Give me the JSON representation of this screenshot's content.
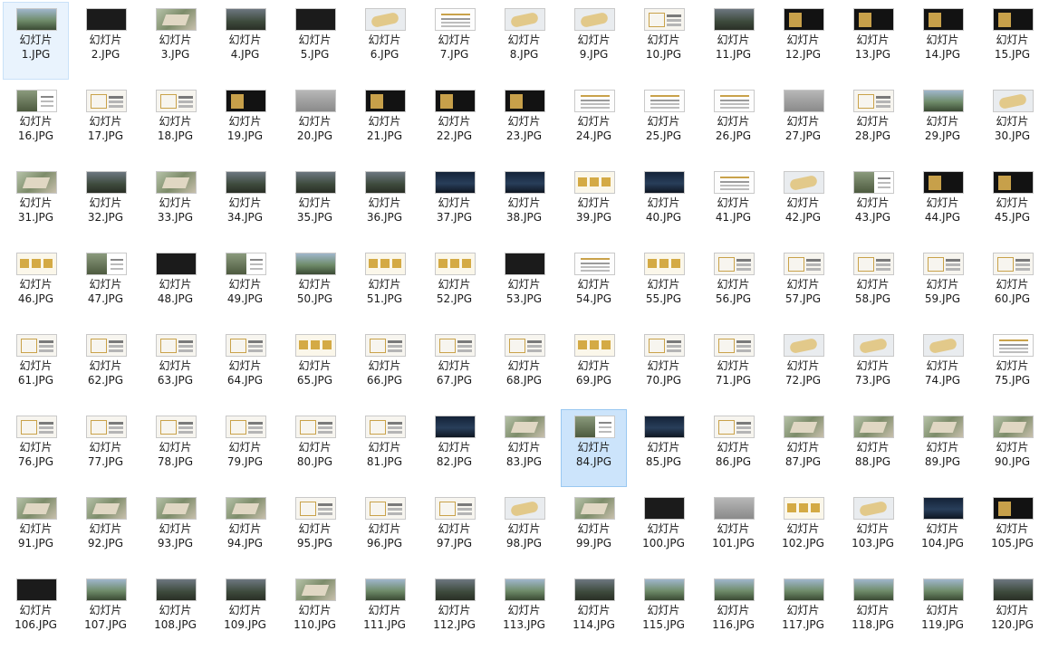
{
  "file_label_prefix": "幻灯片",
  "selected": [
    "84.JPG"
  ],
  "hovered": [
    "1.JPG"
  ],
  "files": [
    {
      "name": "1.JPG",
      "thumb": "t-sky"
    },
    {
      "name": "2.JPG",
      "thumb": "t-dark"
    },
    {
      "name": "3.JPG",
      "thumb": "t-aerial"
    },
    {
      "name": "4.JPG",
      "thumb": "t-photo"
    },
    {
      "name": "5.JPG",
      "thumb": "t-dark"
    },
    {
      "name": "6.JPG",
      "thumb": "t-map"
    },
    {
      "name": "7.JPG",
      "thumb": "t-doc"
    },
    {
      "name": "8.JPG",
      "thumb": "t-map"
    },
    {
      "name": "9.JPG",
      "thumb": "t-map"
    },
    {
      "name": "10.JPG",
      "thumb": "t-plan"
    },
    {
      "name": "11.JPG",
      "thumb": "t-photo"
    },
    {
      "name": "12.JPG",
      "thumb": "t-blackgold"
    },
    {
      "name": "13.JPG",
      "thumb": "t-blackgold"
    },
    {
      "name": "14.JPG",
      "thumb": "t-blackgold"
    },
    {
      "name": "15.JPG",
      "thumb": "t-blackgold"
    },
    {
      "name": "16.JPG",
      "thumb": "t-split"
    },
    {
      "name": "17.JPG",
      "thumb": "t-plan"
    },
    {
      "name": "18.JPG",
      "thumb": "t-plan"
    },
    {
      "name": "19.JPG",
      "thumb": "t-blackgold"
    },
    {
      "name": "20.JPG",
      "thumb": "t-gray"
    },
    {
      "name": "21.JPG",
      "thumb": "t-blackgold"
    },
    {
      "name": "22.JPG",
      "thumb": "t-blackgold"
    },
    {
      "name": "23.JPG",
      "thumb": "t-blackgold"
    },
    {
      "name": "24.JPG",
      "thumb": "t-doc"
    },
    {
      "name": "25.JPG",
      "thumb": "t-doc"
    },
    {
      "name": "26.JPG",
      "thumb": "t-doc"
    },
    {
      "name": "27.JPG",
      "thumb": "t-gray"
    },
    {
      "name": "28.JPG",
      "thumb": "t-plan"
    },
    {
      "name": "29.JPG",
      "thumb": "t-sky"
    },
    {
      "name": "30.JPG",
      "thumb": "t-map"
    },
    {
      "name": "31.JPG",
      "thumb": "t-aerial"
    },
    {
      "name": "32.JPG",
      "thumb": "t-photo"
    },
    {
      "name": "33.JPG",
      "thumb": "t-aerial"
    },
    {
      "name": "34.JPG",
      "thumb": "t-photo"
    },
    {
      "name": "35.JPG",
      "thumb": "t-photo"
    },
    {
      "name": "36.JPG",
      "thumb": "t-photo"
    },
    {
      "name": "37.JPG",
      "thumb": "t-night"
    },
    {
      "name": "38.JPG",
      "thumb": "t-night"
    },
    {
      "name": "39.JPG",
      "thumb": "t-gold"
    },
    {
      "name": "40.JPG",
      "thumb": "t-night"
    },
    {
      "name": "41.JPG",
      "thumb": "t-doc"
    },
    {
      "name": "42.JPG",
      "thumb": "t-map"
    },
    {
      "name": "43.JPG",
      "thumb": "t-split"
    },
    {
      "name": "44.JPG",
      "thumb": "t-blackgold"
    },
    {
      "name": "45.JPG",
      "thumb": "t-blackgold"
    },
    {
      "name": "46.JPG",
      "thumb": "t-gold"
    },
    {
      "name": "47.JPG",
      "thumb": "t-split"
    },
    {
      "name": "48.JPG",
      "thumb": "t-dark"
    },
    {
      "name": "49.JPG",
      "thumb": "t-split"
    },
    {
      "name": "50.JPG",
      "thumb": "t-sky"
    },
    {
      "name": "51.JPG",
      "thumb": "t-gold"
    },
    {
      "name": "52.JPG",
      "thumb": "t-gold"
    },
    {
      "name": "53.JPG",
      "thumb": "t-dark"
    },
    {
      "name": "54.JPG",
      "thumb": "t-doc"
    },
    {
      "name": "55.JPG",
      "thumb": "t-gold"
    },
    {
      "name": "56.JPG",
      "thumb": "t-plan"
    },
    {
      "name": "57.JPG",
      "thumb": "t-plan"
    },
    {
      "name": "58.JPG",
      "thumb": "t-plan"
    },
    {
      "name": "59.JPG",
      "thumb": "t-plan"
    },
    {
      "name": "60.JPG",
      "thumb": "t-plan"
    },
    {
      "name": "61.JPG",
      "thumb": "t-plan"
    },
    {
      "name": "62.JPG",
      "thumb": "t-plan"
    },
    {
      "name": "63.JPG",
      "thumb": "t-plan"
    },
    {
      "name": "64.JPG",
      "thumb": "t-plan"
    },
    {
      "name": "65.JPG",
      "thumb": "t-gold"
    },
    {
      "name": "66.JPG",
      "thumb": "t-plan"
    },
    {
      "name": "67.JPG",
      "thumb": "t-plan"
    },
    {
      "name": "68.JPG",
      "thumb": "t-plan"
    },
    {
      "name": "69.JPG",
      "thumb": "t-gold"
    },
    {
      "name": "70.JPG",
      "thumb": "t-plan"
    },
    {
      "name": "71.JPG",
      "thumb": "t-plan"
    },
    {
      "name": "72.JPG",
      "thumb": "t-map"
    },
    {
      "name": "73.JPG",
      "thumb": "t-map"
    },
    {
      "name": "74.JPG",
      "thumb": "t-map"
    },
    {
      "name": "75.JPG",
      "thumb": "t-doc"
    },
    {
      "name": "76.JPG",
      "thumb": "t-plan"
    },
    {
      "name": "77.JPG",
      "thumb": "t-plan"
    },
    {
      "name": "78.JPG",
      "thumb": "t-plan"
    },
    {
      "name": "79.JPG",
      "thumb": "t-plan"
    },
    {
      "name": "80.JPG",
      "thumb": "t-plan"
    },
    {
      "name": "81.JPG",
      "thumb": "t-plan"
    },
    {
      "name": "82.JPG",
      "thumb": "t-night"
    },
    {
      "name": "83.JPG",
      "thumb": "t-aerial"
    },
    {
      "name": "84.JPG",
      "thumb": "t-split"
    },
    {
      "name": "85.JPG",
      "thumb": "t-night"
    },
    {
      "name": "86.JPG",
      "thumb": "t-plan"
    },
    {
      "name": "87.JPG",
      "thumb": "t-aerial"
    },
    {
      "name": "88.JPG",
      "thumb": "t-aerial"
    },
    {
      "name": "89.JPG",
      "thumb": "t-aerial"
    },
    {
      "name": "90.JPG",
      "thumb": "t-aerial"
    },
    {
      "name": "91.JPG",
      "thumb": "t-aerial"
    },
    {
      "name": "92.JPG",
      "thumb": "t-aerial"
    },
    {
      "name": "93.JPG",
      "thumb": "t-aerial"
    },
    {
      "name": "94.JPG",
      "thumb": "t-aerial"
    },
    {
      "name": "95.JPG",
      "thumb": "t-plan"
    },
    {
      "name": "96.JPG",
      "thumb": "t-plan"
    },
    {
      "name": "97.JPG",
      "thumb": "t-plan"
    },
    {
      "name": "98.JPG",
      "thumb": "t-map"
    },
    {
      "name": "99.JPG",
      "thumb": "t-aerial"
    },
    {
      "name": "100.JPG",
      "thumb": "t-dark"
    },
    {
      "name": "101.JPG",
      "thumb": "t-gray"
    },
    {
      "name": "102.JPG",
      "thumb": "t-gold"
    },
    {
      "name": "103.JPG",
      "thumb": "t-map"
    },
    {
      "name": "104.JPG",
      "thumb": "t-night"
    },
    {
      "name": "105.JPG",
      "thumb": "t-blackgold"
    },
    {
      "name": "106.JPG",
      "thumb": "t-dark"
    },
    {
      "name": "107.JPG",
      "thumb": "t-sky"
    },
    {
      "name": "108.JPG",
      "thumb": "t-photo"
    },
    {
      "name": "109.JPG",
      "thumb": "t-photo"
    },
    {
      "name": "110.JPG",
      "thumb": "t-aerial"
    },
    {
      "name": "111.JPG",
      "thumb": "t-sky"
    },
    {
      "name": "112.JPG",
      "thumb": "t-photo"
    },
    {
      "name": "113.JPG",
      "thumb": "t-sky"
    },
    {
      "name": "114.JPG",
      "thumb": "t-photo"
    },
    {
      "name": "115.JPG",
      "thumb": "t-sky"
    },
    {
      "name": "116.JPG",
      "thumb": "t-sky"
    },
    {
      "name": "117.JPG",
      "thumb": "t-sky"
    },
    {
      "name": "118.JPG",
      "thumb": "t-sky"
    },
    {
      "name": "119.JPG",
      "thumb": "t-sky"
    },
    {
      "name": "120.JPG",
      "thumb": "t-photo"
    }
  ]
}
